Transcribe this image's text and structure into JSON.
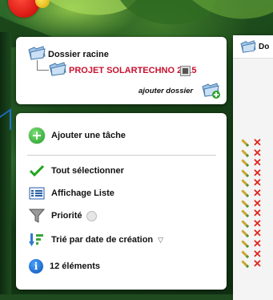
{
  "tree": {
    "root_label": "Dossier racine",
    "project_label": "PROJET SOLARTECHNO 2015",
    "add_folder_label": "ajouter dossier"
  },
  "tasks_menu": {
    "add_task": "Ajouter une tâche",
    "select_all": "Tout sélectionner",
    "list_view": "Affichage Liste",
    "priority": "Priorité",
    "sort": "Trié par date de création",
    "count": "12 éléments"
  },
  "right_panel": {
    "header_label": "Do"
  },
  "task_rows": [
    1,
    2,
    3,
    4,
    5,
    6,
    7,
    8,
    9,
    10,
    11,
    12,
    13
  ],
  "colors": {
    "project_red": "#c8102e",
    "add_green": "#1f9b22",
    "info_blue": "#0a4fb3",
    "delete_red": "#e0261e"
  }
}
